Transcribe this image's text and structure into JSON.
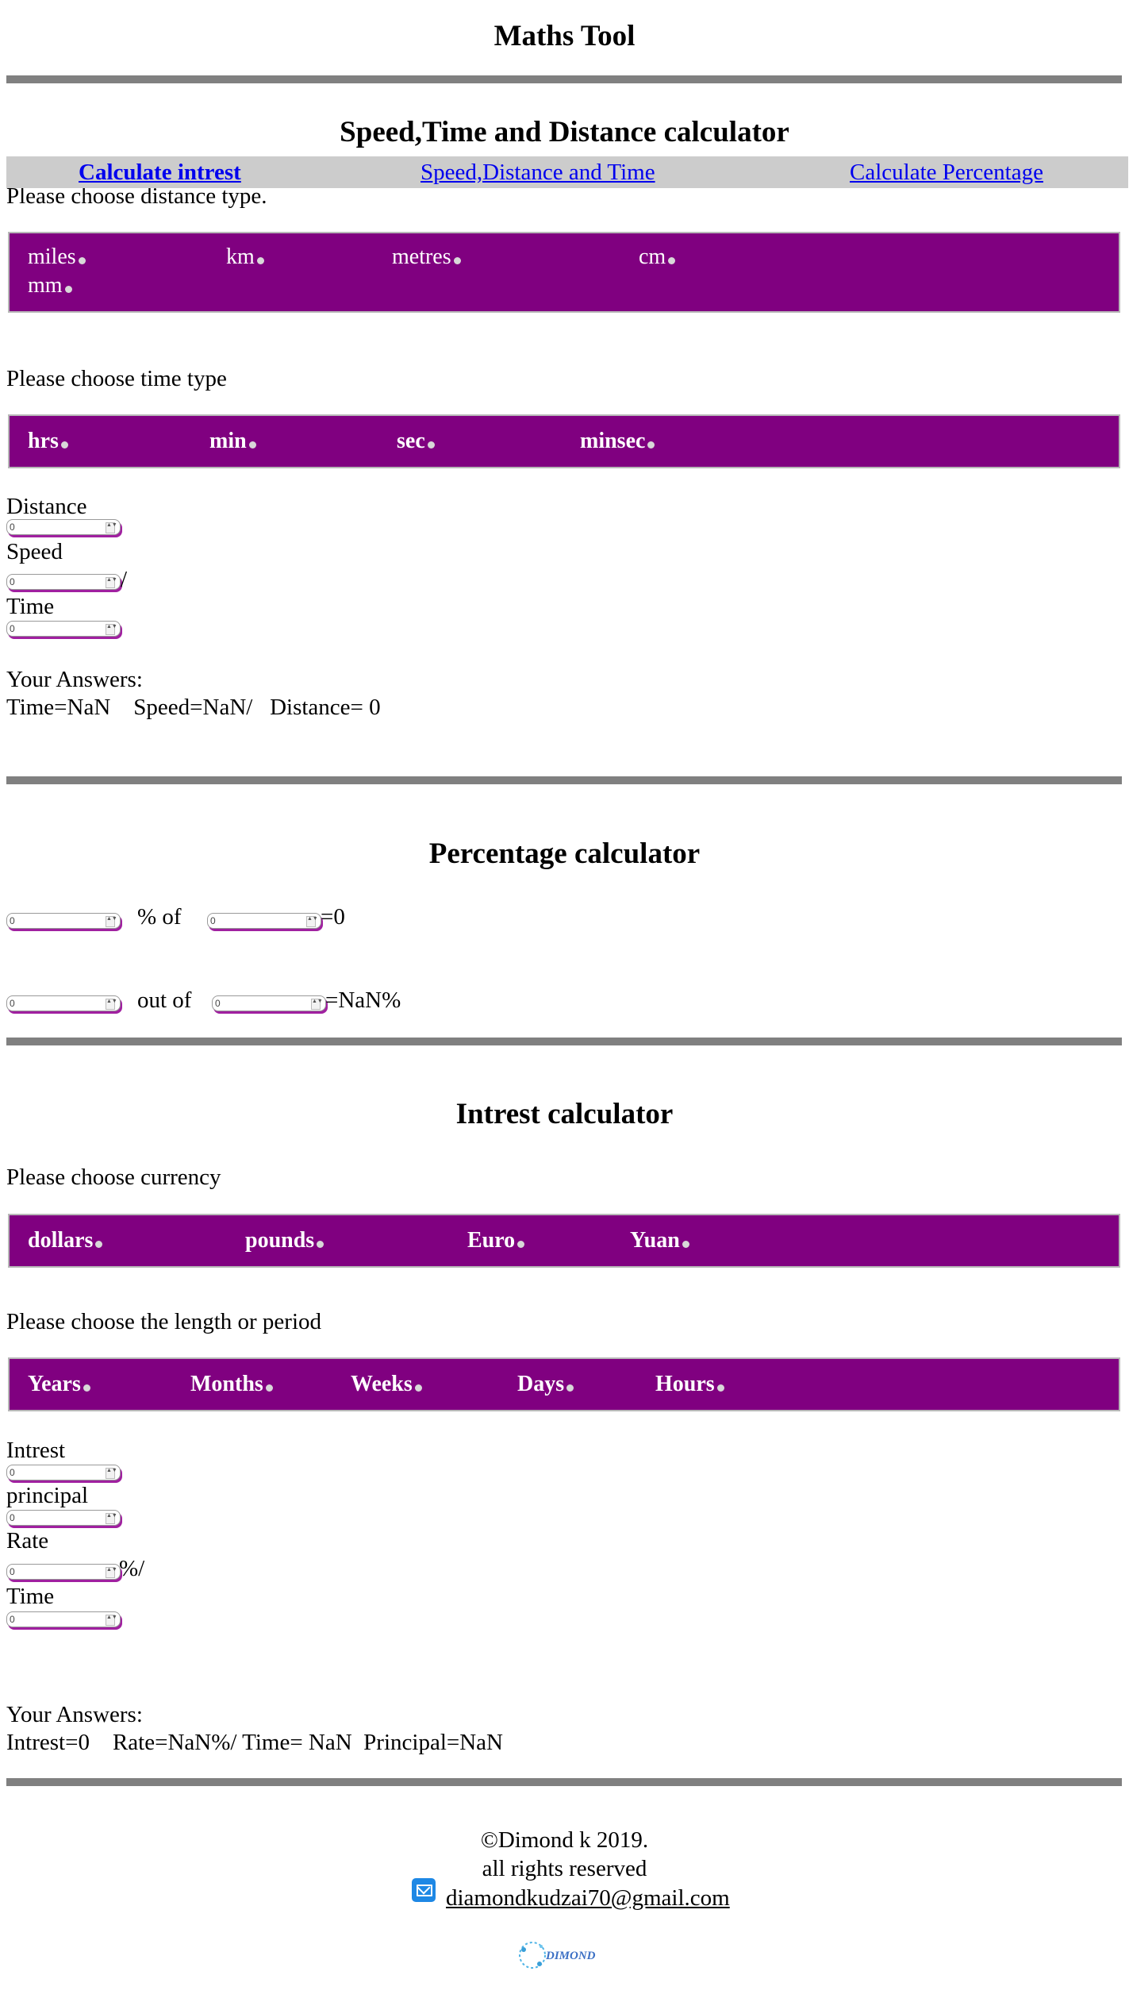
{
  "header": {
    "title": "Maths Tool"
  },
  "speed_section": {
    "title": "Speed,Time and Distance calculator",
    "distance_prompt": "Please choose distance type.",
    "distance_types": [
      "miles",
      "km",
      "metres",
      "cm",
      "mm"
    ],
    "time_prompt": "Please choose time type",
    "time_types": [
      "hrs",
      "min",
      "sec",
      "minsec"
    ],
    "distance_label": "Distance",
    "distance_value": "0",
    "speed_label": "Speed",
    "speed_value": "0",
    "speed_suffix": "/",
    "time_label": "Time",
    "time_value": "0",
    "answers_label": "Your Answers:",
    "answers_text": "Time=NaN    Speed=NaN/   Distance= 0"
  },
  "nav": {
    "links": [
      "Calculate intrest",
      "Speed,Distance and Time",
      "Calculate Percentage"
    ]
  },
  "percentage_section": {
    "title": "Percentage calculator",
    "row1": {
      "value_a": "0",
      "label": "% of",
      "value_b": "0",
      "result": "=0"
    },
    "row2": {
      "value_a": "0",
      "label": "out of",
      "value_b": "0",
      "result": "=NaN%"
    }
  },
  "interest_section": {
    "title": "Intrest calculator",
    "currency_prompt": "Please choose currency",
    "currencies": [
      "dollars",
      "pounds",
      "Euro",
      "Yuan"
    ],
    "period_prompt": "Please choose the length or period",
    "periods": [
      "Years",
      "Months",
      "Weeks",
      "Days",
      "Hours"
    ],
    "intrest_label": "Intrest",
    "intrest_value": "0",
    "principal_label": "principal",
    "principal_value": "0",
    "rate_label": "Rate",
    "rate_value": "0",
    "rate_suffix": "%/",
    "time_label": "Time",
    "time_value": "0",
    "answers_label": "Your Answers:",
    "answers_text": "Intrest=0    Rate=NaN%/ Time= NaN  Principal=NaN"
  },
  "footer": {
    "copyright": "©Dimond k 2019.",
    "rights": "all rights reserved",
    "email": "diamondkudzai70@gmail.com",
    "logo_text": "DIMOND"
  },
  "colors": {
    "option_bar": "#800080",
    "nav_bar": "#cccccc",
    "rule": "#808080",
    "link": "#0000ee"
  }
}
